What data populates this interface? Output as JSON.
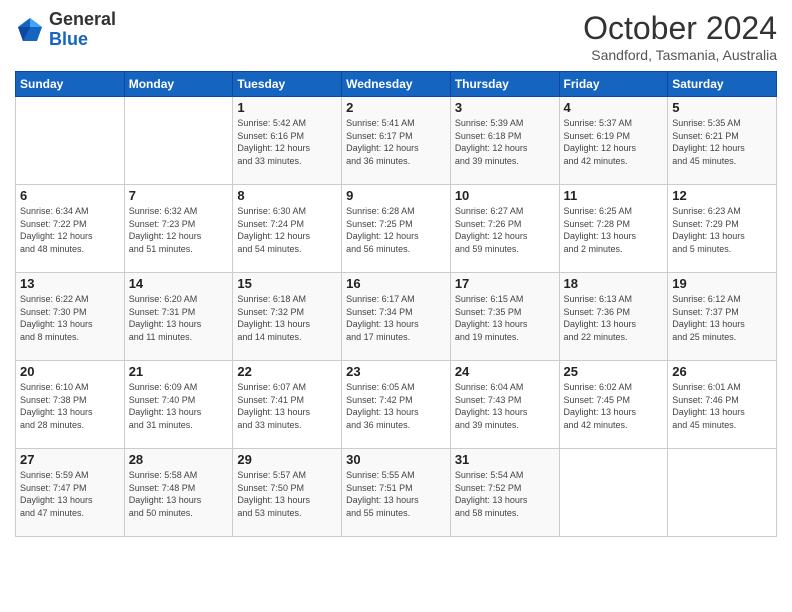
{
  "logo": {
    "line1": "General",
    "line2": "Blue"
  },
  "header": {
    "title": "October 2024",
    "subtitle": "Sandford, Tasmania, Australia"
  },
  "weekdays": [
    "Sunday",
    "Monday",
    "Tuesday",
    "Wednesday",
    "Thursday",
    "Friday",
    "Saturday"
  ],
  "weeks": [
    [
      {
        "day": "",
        "info": ""
      },
      {
        "day": "",
        "info": ""
      },
      {
        "day": "1",
        "info": "Sunrise: 5:42 AM\nSunset: 6:16 PM\nDaylight: 12 hours\nand 33 minutes."
      },
      {
        "day": "2",
        "info": "Sunrise: 5:41 AM\nSunset: 6:17 PM\nDaylight: 12 hours\nand 36 minutes."
      },
      {
        "day": "3",
        "info": "Sunrise: 5:39 AM\nSunset: 6:18 PM\nDaylight: 12 hours\nand 39 minutes."
      },
      {
        "day": "4",
        "info": "Sunrise: 5:37 AM\nSunset: 6:19 PM\nDaylight: 12 hours\nand 42 minutes."
      },
      {
        "day": "5",
        "info": "Sunrise: 5:35 AM\nSunset: 6:21 PM\nDaylight: 12 hours\nand 45 minutes."
      }
    ],
    [
      {
        "day": "6",
        "info": "Sunrise: 6:34 AM\nSunset: 7:22 PM\nDaylight: 12 hours\nand 48 minutes."
      },
      {
        "day": "7",
        "info": "Sunrise: 6:32 AM\nSunset: 7:23 PM\nDaylight: 12 hours\nand 51 minutes."
      },
      {
        "day": "8",
        "info": "Sunrise: 6:30 AM\nSunset: 7:24 PM\nDaylight: 12 hours\nand 54 minutes."
      },
      {
        "day": "9",
        "info": "Sunrise: 6:28 AM\nSunset: 7:25 PM\nDaylight: 12 hours\nand 56 minutes."
      },
      {
        "day": "10",
        "info": "Sunrise: 6:27 AM\nSunset: 7:26 PM\nDaylight: 12 hours\nand 59 minutes."
      },
      {
        "day": "11",
        "info": "Sunrise: 6:25 AM\nSunset: 7:28 PM\nDaylight: 13 hours\nand 2 minutes."
      },
      {
        "day": "12",
        "info": "Sunrise: 6:23 AM\nSunset: 7:29 PM\nDaylight: 13 hours\nand 5 minutes."
      }
    ],
    [
      {
        "day": "13",
        "info": "Sunrise: 6:22 AM\nSunset: 7:30 PM\nDaylight: 13 hours\nand 8 minutes."
      },
      {
        "day": "14",
        "info": "Sunrise: 6:20 AM\nSunset: 7:31 PM\nDaylight: 13 hours\nand 11 minutes."
      },
      {
        "day": "15",
        "info": "Sunrise: 6:18 AM\nSunset: 7:32 PM\nDaylight: 13 hours\nand 14 minutes."
      },
      {
        "day": "16",
        "info": "Sunrise: 6:17 AM\nSunset: 7:34 PM\nDaylight: 13 hours\nand 17 minutes."
      },
      {
        "day": "17",
        "info": "Sunrise: 6:15 AM\nSunset: 7:35 PM\nDaylight: 13 hours\nand 19 minutes."
      },
      {
        "day": "18",
        "info": "Sunrise: 6:13 AM\nSunset: 7:36 PM\nDaylight: 13 hours\nand 22 minutes."
      },
      {
        "day": "19",
        "info": "Sunrise: 6:12 AM\nSunset: 7:37 PM\nDaylight: 13 hours\nand 25 minutes."
      }
    ],
    [
      {
        "day": "20",
        "info": "Sunrise: 6:10 AM\nSunset: 7:38 PM\nDaylight: 13 hours\nand 28 minutes."
      },
      {
        "day": "21",
        "info": "Sunrise: 6:09 AM\nSunset: 7:40 PM\nDaylight: 13 hours\nand 31 minutes."
      },
      {
        "day": "22",
        "info": "Sunrise: 6:07 AM\nSunset: 7:41 PM\nDaylight: 13 hours\nand 33 minutes."
      },
      {
        "day": "23",
        "info": "Sunrise: 6:05 AM\nSunset: 7:42 PM\nDaylight: 13 hours\nand 36 minutes."
      },
      {
        "day": "24",
        "info": "Sunrise: 6:04 AM\nSunset: 7:43 PM\nDaylight: 13 hours\nand 39 minutes."
      },
      {
        "day": "25",
        "info": "Sunrise: 6:02 AM\nSunset: 7:45 PM\nDaylight: 13 hours\nand 42 minutes."
      },
      {
        "day": "26",
        "info": "Sunrise: 6:01 AM\nSunset: 7:46 PM\nDaylight: 13 hours\nand 45 minutes."
      }
    ],
    [
      {
        "day": "27",
        "info": "Sunrise: 5:59 AM\nSunset: 7:47 PM\nDaylight: 13 hours\nand 47 minutes."
      },
      {
        "day": "28",
        "info": "Sunrise: 5:58 AM\nSunset: 7:48 PM\nDaylight: 13 hours\nand 50 minutes."
      },
      {
        "day": "29",
        "info": "Sunrise: 5:57 AM\nSunset: 7:50 PM\nDaylight: 13 hours\nand 53 minutes."
      },
      {
        "day": "30",
        "info": "Sunrise: 5:55 AM\nSunset: 7:51 PM\nDaylight: 13 hours\nand 55 minutes."
      },
      {
        "day": "31",
        "info": "Sunrise: 5:54 AM\nSunset: 7:52 PM\nDaylight: 13 hours\nand 58 minutes."
      },
      {
        "day": "",
        "info": ""
      },
      {
        "day": "",
        "info": ""
      }
    ]
  ]
}
